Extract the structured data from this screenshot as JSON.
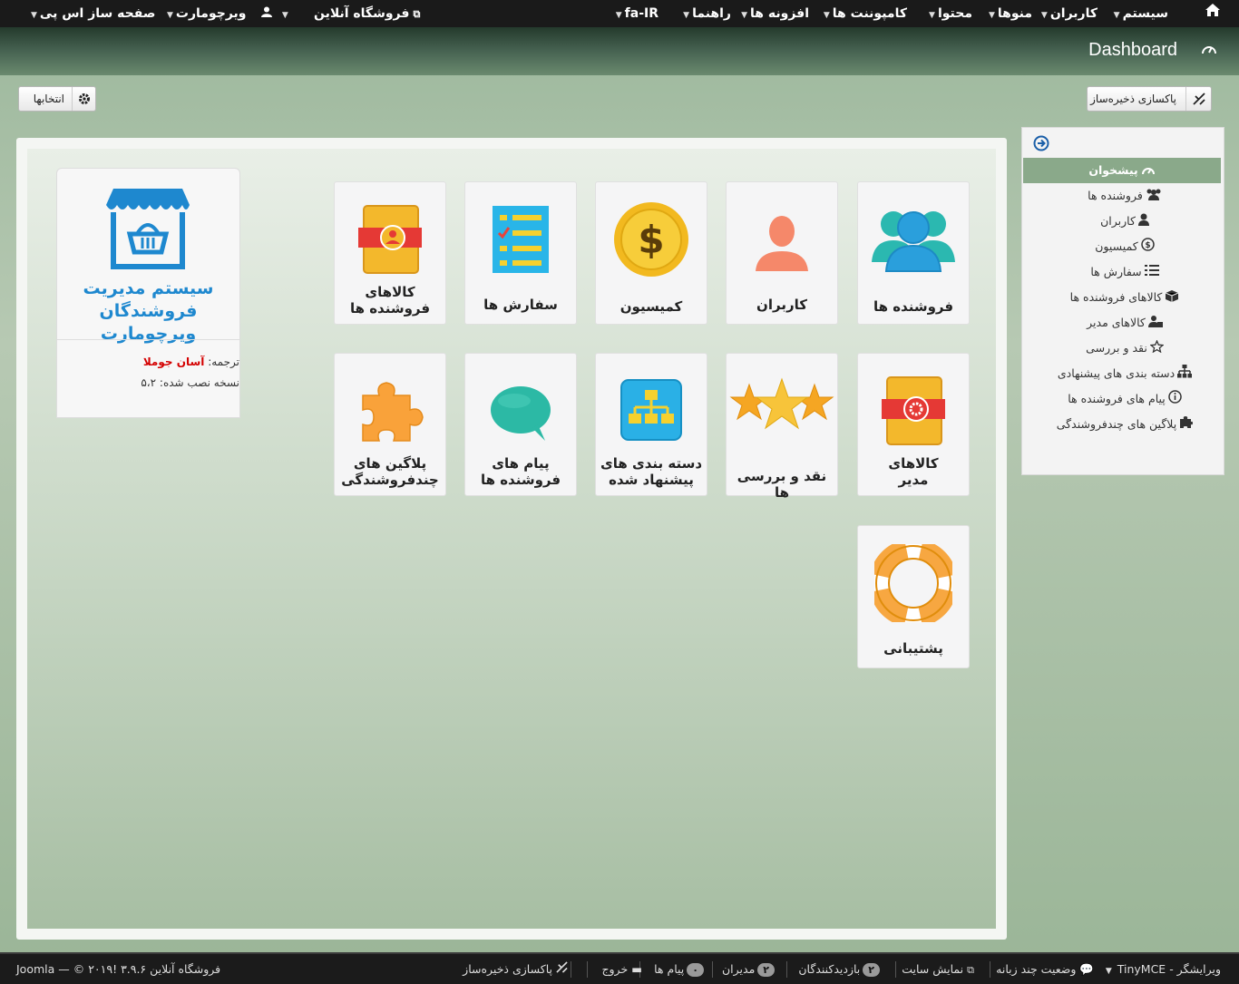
{
  "topnav": {
    "home_icon": "home-icon",
    "items": [
      {
        "label": "سیستم"
      },
      {
        "label": "کاربران"
      },
      {
        "label": "منوها"
      },
      {
        "label": "محتوا"
      },
      {
        "label": "کامپوننت ها"
      },
      {
        "label": "افزونه ها"
      },
      {
        "label": "راهنما"
      },
      {
        "label": "fa-IR"
      }
    ],
    "left_items": [
      {
        "label": "فروشگاه آنلاین"
      },
      {
        "label": "ویرچومارت"
      },
      {
        "label": "صفحه ساز اس پی"
      }
    ]
  },
  "header": {
    "title": "Dashboard"
  },
  "toolbar": {
    "clear_cache": "پاکسازی ذخیره‌ساز",
    "options": "انتخابها"
  },
  "info": {
    "brand_line1": "سیستم   مدیریت",
    "brand_line2": "فروشندگان   ویرچومارت",
    "translation_label": "ترجمه:",
    "translation_value": "آسان جوملا",
    "version_label": "نسخه نصب شده:",
    "version_value": "۵،۲"
  },
  "tiles": [
    {
      "l1": "فروشنده ها",
      "l2": ""
    },
    {
      "l1": "کاربران",
      "l2": ""
    },
    {
      "l1": "کمیسیون",
      "l2": ""
    },
    {
      "l1": "سفارش ها",
      "l2": ""
    },
    {
      "l1": "کالاهای",
      "l2": "فروشنده ها"
    },
    {
      "l1": "کالاهای",
      "l2": "مدیر"
    },
    {
      "l1": "نقد و بررسی ها",
      "l2": ""
    },
    {
      "l1": "دسته بندی های",
      "l2": "پیشنهاد شده"
    },
    {
      "l1": "پیام های",
      "l2": "فروشنده ها"
    },
    {
      "l1": "پلاگین های",
      "l2": "چندفروشندگی"
    },
    {
      "l1": "پشتیبانی",
      "l2": ""
    }
  ],
  "sidebar": {
    "items": [
      {
        "label": "پیشخوان"
      },
      {
        "label": "فروشنده ها"
      },
      {
        "label": "کاربران"
      },
      {
        "label": "کمیسیون"
      },
      {
        "label": "سفارش ها"
      },
      {
        "label": "کالاهای فروشنده ها"
      },
      {
        "label": "کالاهای مدیر"
      },
      {
        "label": "نقد و بررسی"
      },
      {
        "label": "دسته بندی های پیشنهادی"
      },
      {
        "label": "پیام های فروشنده ها"
      },
      {
        "label": "پلاگین های چندفروشندگی"
      }
    ]
  },
  "footer": {
    "editor": "ویرایشگر - TinyMCE",
    "multilang": "وضعیت چند زبانه",
    "view_site": "نمایش سایت",
    "visitors_count": "۲",
    "visitors": "بازدیدکنندگان",
    "admins_count": "۲",
    "admins": "مدیران",
    "messages_count": "۰",
    "messages": "پیام ها",
    "logout": "خروج",
    "clear_cache": "پاکسازی ذخیره‌ساز",
    "copyright": "فروشگاه آنلاین ۳.۹.۶ !Joomla — © ۲۰۱۹"
  }
}
